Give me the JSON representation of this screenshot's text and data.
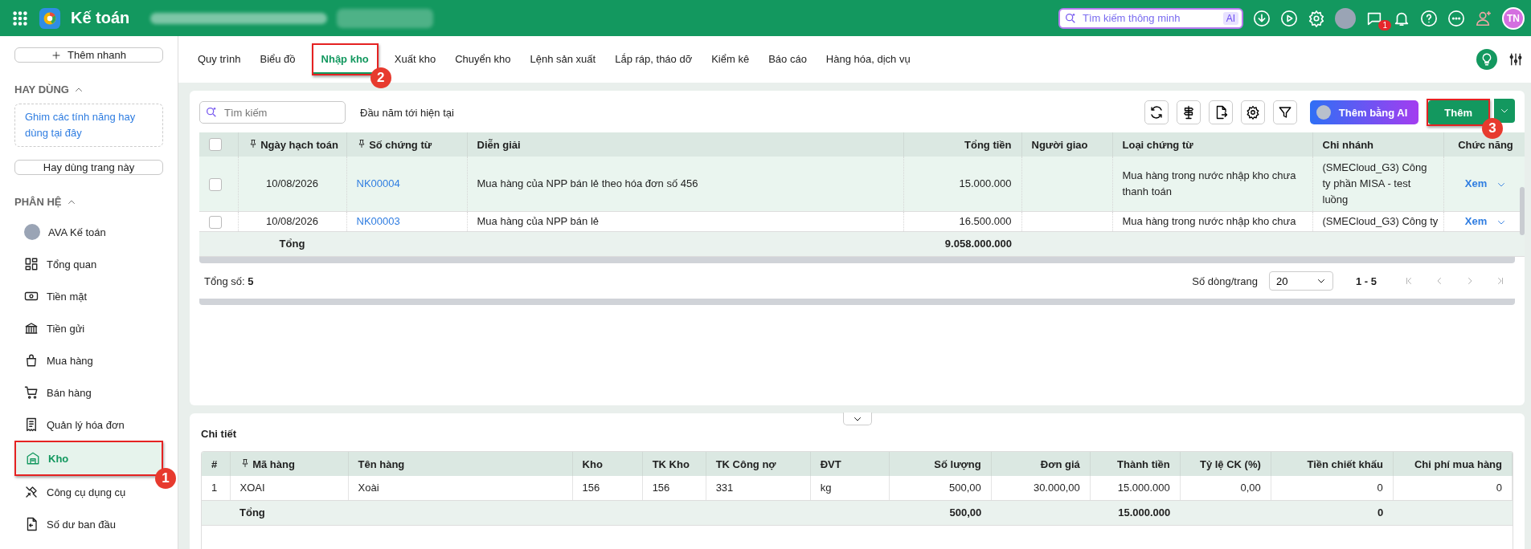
{
  "topbar": {
    "app_title": "Kế toán",
    "search": {
      "placeholder": "Tìm kiếm thông minh",
      "badge": "AI"
    },
    "notification_count": "1",
    "avatar_initials": "TN"
  },
  "sidebar": {
    "quick_add": "Thêm nhanh",
    "favorites": {
      "title": "HAY DÙNG",
      "expanded": true,
      "hint": "Ghim các tính năng hay dùng tại đây",
      "button": "Hay dùng trang này"
    },
    "modules": {
      "title": "PHÂN HỆ",
      "expanded": true,
      "items": [
        {
          "label": "AVA Kế toán",
          "selected": false
        },
        {
          "label": "Tổng quan",
          "selected": false
        },
        {
          "label": "Tiền mặt",
          "selected": false
        },
        {
          "label": "Tiền gửi",
          "selected": false
        },
        {
          "label": "Mua hàng",
          "selected": false
        },
        {
          "label": "Bán hàng",
          "selected": false
        },
        {
          "label": "Quản lý hóa đơn",
          "selected": false
        },
        {
          "label": "Kho",
          "selected": true,
          "callout": "1"
        },
        {
          "label": "Công cụ dụng cụ",
          "selected": false
        },
        {
          "label": "Số dư ban đầu",
          "selected": false
        }
      ]
    }
  },
  "tabs": [
    {
      "label": "Quy trình",
      "selected": false
    },
    {
      "label": "Biểu đồ",
      "selected": false
    },
    {
      "label": "Nhập kho",
      "selected": true,
      "callout": "2"
    },
    {
      "label": "Xuất kho",
      "selected": false
    },
    {
      "label": "Chuyển kho",
      "selected": false
    },
    {
      "label": "Lệnh sản xuất",
      "selected": false
    },
    {
      "label": "Lắp ráp, tháo dỡ",
      "selected": false
    },
    {
      "label": "Kiểm kê",
      "selected": false
    },
    {
      "label": "Báo cáo",
      "selected": false
    },
    {
      "label": "Hàng hóa, dịch vụ",
      "selected": false
    }
  ],
  "toolbar": {
    "search": {
      "placeholder": "Tìm kiếm"
    },
    "period": "Đầu năm tới hiện tại",
    "add_ai_button": "Thêm bằng AI",
    "add_button": {
      "label": "Thêm",
      "callout": "3"
    }
  },
  "table": {
    "select_all": {
      "checked": false
    },
    "columns": [
      {
        "label": "Ngày hạch toán",
        "pinned": true,
        "kind": "center"
      },
      {
        "label": "Số chứng từ",
        "pinned": true,
        "kind": "link"
      },
      {
        "label": "Diễn giải",
        "pinned": false,
        "kind": "text"
      },
      {
        "label": "Tổng tiền",
        "pinned": false,
        "kind": "number"
      },
      {
        "label": "Người giao",
        "pinned": false,
        "kind": "text"
      },
      {
        "label": "Loại chứng từ",
        "pinned": false,
        "kind": "text"
      },
      {
        "label": "Chi nhánh",
        "pinned": false,
        "kind": "text"
      },
      {
        "label": "Chức năng",
        "pinned": false,
        "kind": "action"
      }
    ],
    "rows": [
      {
        "checked": false,
        "selected": true,
        "cells": [
          "10/08/2026",
          "NK00004",
          "Mua hàng của NPP bán lẻ theo hóa đơn số 456",
          "15.000.000",
          null,
          "Mua hàng trong nước nhập kho chưa thanh toán",
          "(SMECloud_G3) Công ty phần MISA - test luồng",
          "Xem"
        ]
      },
      {
        "checked": false,
        "selected": false,
        "cells": [
          "10/08/2026",
          "NK00003",
          "Mua hàng của NPP bán lẻ",
          "16.500.000",
          null,
          "Mua hàng trong nước nhập kho chưa",
          "(SMECloud_G3) Công ty",
          "Xem"
        ]
      }
    ],
    "totals": {
      "label": "Tổng",
      "total": "9.058.000.000"
    }
  },
  "pagination": {
    "total_label": "Tổng số: **5**",
    "rows_per_page_label": "Số dòng/trang",
    "rows_per_page": "20",
    "range": "1 - 5"
  },
  "detail": {
    "title": "Chi tiết",
    "columns": [
      {
        "label": "#",
        "pinned": false,
        "kind": "text"
      },
      {
        "label": "Mã hàng",
        "pinned": true,
        "kind": "text"
      },
      {
        "label": "Tên hàng",
        "pinned": false,
        "kind": "text"
      },
      {
        "label": "Kho",
        "pinned": false,
        "kind": "text"
      },
      {
        "label": "TK Kho",
        "pinned": false,
        "kind": "text"
      },
      {
        "label": "TK Công nợ",
        "pinned": false,
        "kind": "text"
      },
      {
        "label": "ĐVT",
        "pinned": false,
        "kind": "text"
      },
      {
        "label": "Số lượng",
        "pinned": false,
        "kind": "number"
      },
      {
        "label": "Đơn giá",
        "pinned": false,
        "kind": "number"
      },
      {
        "label": "Thành tiền",
        "pinned": false,
        "kind": "number"
      },
      {
        "label": "Tỷ lệ CK (%)",
        "pinned": false,
        "kind": "number"
      },
      {
        "label": "Tiền chiết khấu",
        "pinned": false,
        "kind": "number"
      },
      {
        "label": "Chi phí mua hàng",
        "pinned": false,
        "kind": "number"
      }
    ],
    "rows": [
      {
        "cells": [
          "1",
          "XOAI",
          "Xoài",
          "156",
          "156",
          "331",
          "kg",
          "500,00",
          "30.000,00",
          "15.000.000",
          "0,00",
          "0",
          "0"
        ]
      }
    ],
    "expanded": true,
    "totals": {
      "label": "Tổng",
      "quantity": "500,00",
      "amount": "15.000.000",
      "discount": "0"
    }
  }
}
